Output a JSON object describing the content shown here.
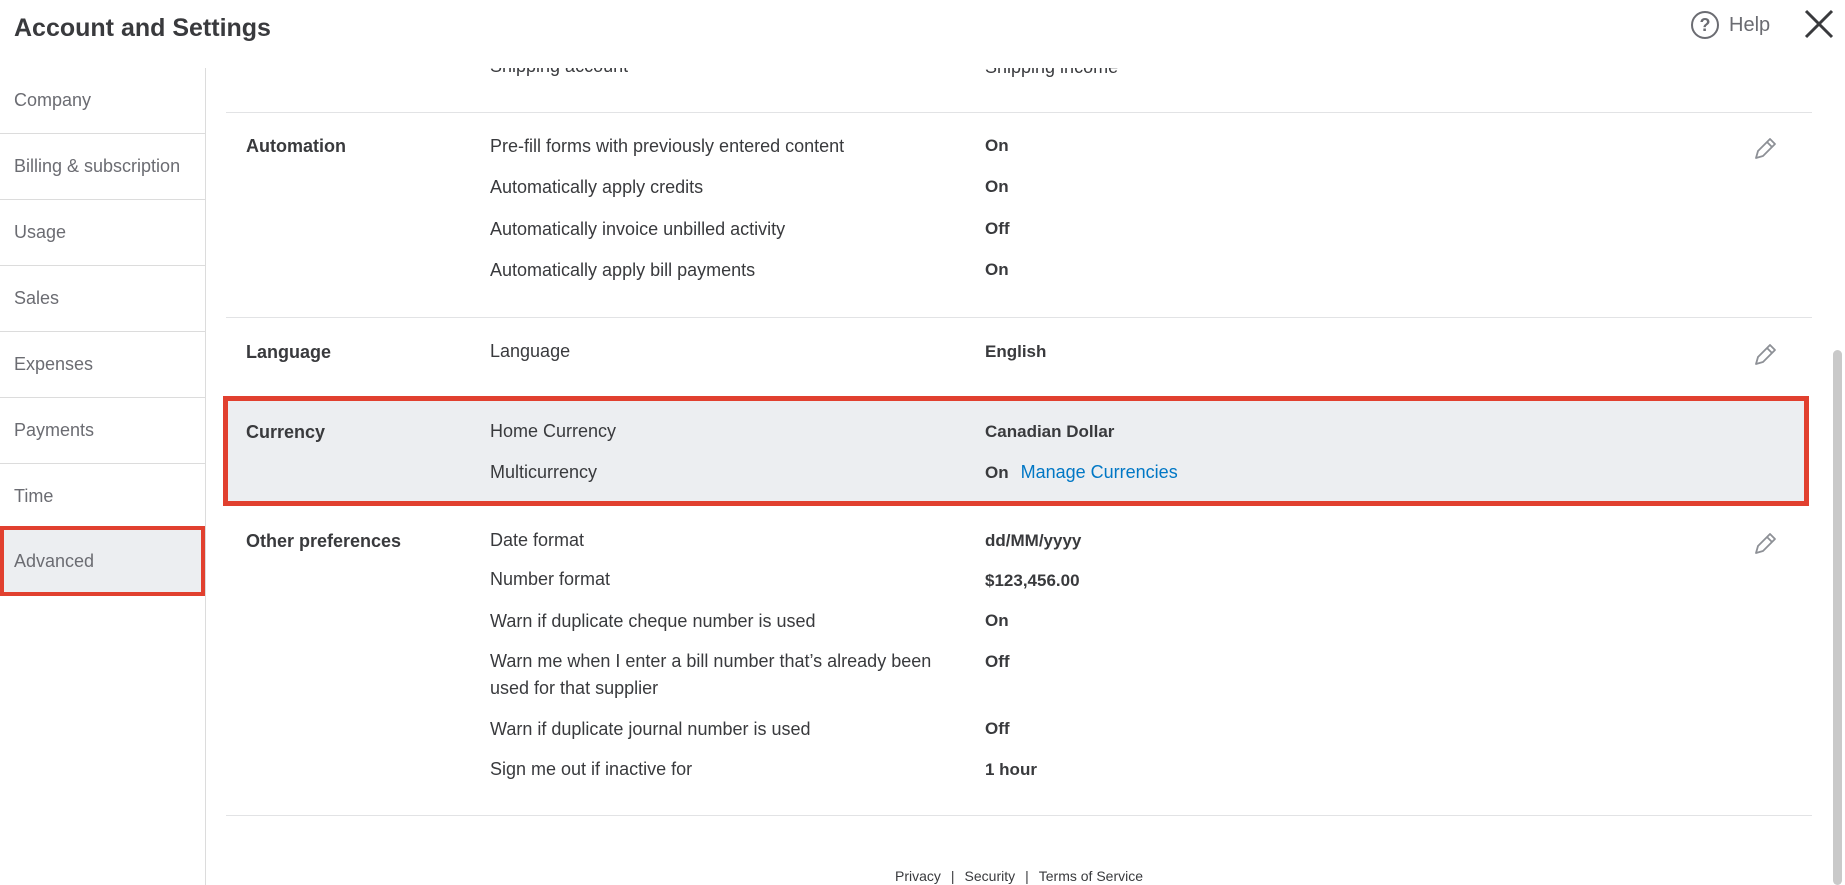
{
  "header": {
    "title": "Account and Settings",
    "help_label": "Help"
  },
  "sidebar": {
    "items": [
      {
        "label": "Company"
      },
      {
        "label": "Billing & subscription"
      },
      {
        "label": "Usage"
      },
      {
        "label": "Sales"
      },
      {
        "label": "Expenses"
      },
      {
        "label": "Payments"
      },
      {
        "label": "Time"
      },
      {
        "label": "Advanced"
      }
    ],
    "active": "Advanced"
  },
  "cut_off": {
    "label": "Shipping account",
    "value": "Shipping income"
  },
  "sections": {
    "automation": {
      "title": "Automation",
      "rows": [
        {
          "label": "Pre-fill forms with previously entered content",
          "value": "On"
        },
        {
          "label": "Automatically apply credits",
          "value": "On"
        },
        {
          "label": "Automatically invoice unbilled activity",
          "value": "Off"
        },
        {
          "label": "Automatically apply bill payments",
          "value": "On"
        }
      ]
    },
    "language": {
      "title": "Language",
      "rows": [
        {
          "label": "Language",
          "value": "English"
        }
      ]
    },
    "currency": {
      "title": "Currency",
      "rows": [
        {
          "label": "Home Currency",
          "value": "Canadian Dollar"
        },
        {
          "label": "Multicurrency",
          "value": "On",
          "link": "Manage Currencies"
        }
      ]
    },
    "other": {
      "title": "Other preferences",
      "rows": [
        {
          "label": "Date format",
          "value": "dd/MM/yyyy"
        },
        {
          "label": "Number format",
          "value": "$123,456.00"
        },
        {
          "label": "Warn if duplicate cheque number is used",
          "value": "On"
        },
        {
          "label": "Warn me when I enter a bill number that’s already been used for that supplier",
          "value": "Off"
        },
        {
          "label": "Warn if duplicate journal number is used",
          "value": "Off"
        },
        {
          "label": "Sign me out if inactive for",
          "value": "1 hour"
        }
      ]
    }
  },
  "footer": {
    "links": [
      "Privacy",
      "Security",
      "Terms of Service"
    ],
    "separator": "|"
  },
  "colors": {
    "highlight": "#e1402f",
    "link": "#0077c5",
    "selected_bg": "#eceef1"
  }
}
